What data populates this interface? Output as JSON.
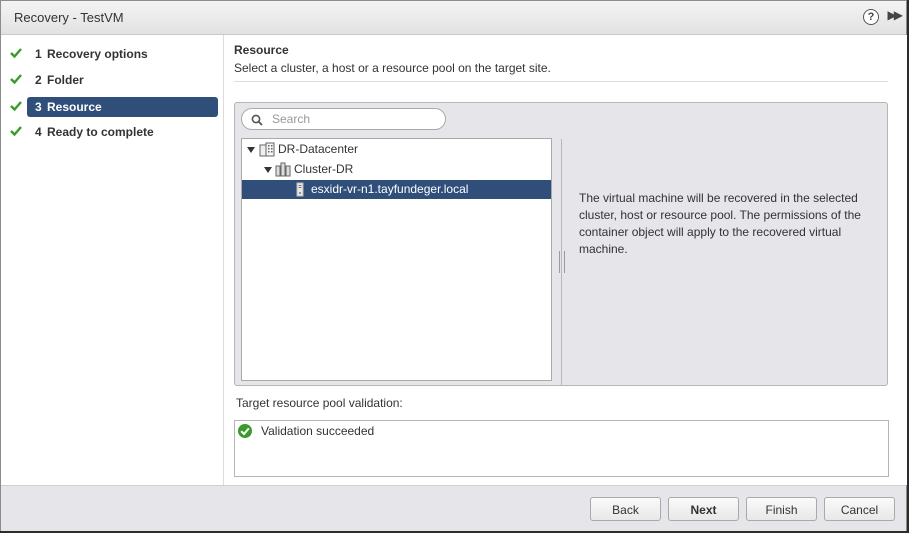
{
  "window": {
    "title": "Recovery - TestVM",
    "help_glyph": "?",
    "expand_glyph": "▶▶"
  },
  "steps": [
    {
      "num": "1",
      "label": "Recovery options",
      "state": "done"
    },
    {
      "num": "2",
      "label": "Folder",
      "state": "done"
    },
    {
      "num": "3",
      "label": "Resource",
      "state": "active"
    },
    {
      "num": "4",
      "label": "Ready to complete",
      "state": "done"
    }
  ],
  "resource": {
    "title": "Resource",
    "subtitle": "Select a cluster, a host or a resource pool on the target site.",
    "search": {
      "placeholder": "Search",
      "value": ""
    },
    "tree": {
      "datacenter": "DR-Datacenter",
      "cluster": "Cluster-DR",
      "host": "esxidr-vr-n1.tayfundeger.local"
    },
    "info": "The virtual machine will be recovered in the selected cluster, host or resource pool. The permissions of the container object will apply to the recovered virtual machine."
  },
  "validation": {
    "label": "Target resource pool validation:",
    "message": "Validation succeeded"
  },
  "buttons": {
    "back": "Back",
    "next": "Next",
    "finish": "Finish",
    "cancel": "Cancel"
  },
  "colors": {
    "selected": "#2f4f7a",
    "check": "#3a9a2a",
    "panel": "#e5e5ea"
  }
}
